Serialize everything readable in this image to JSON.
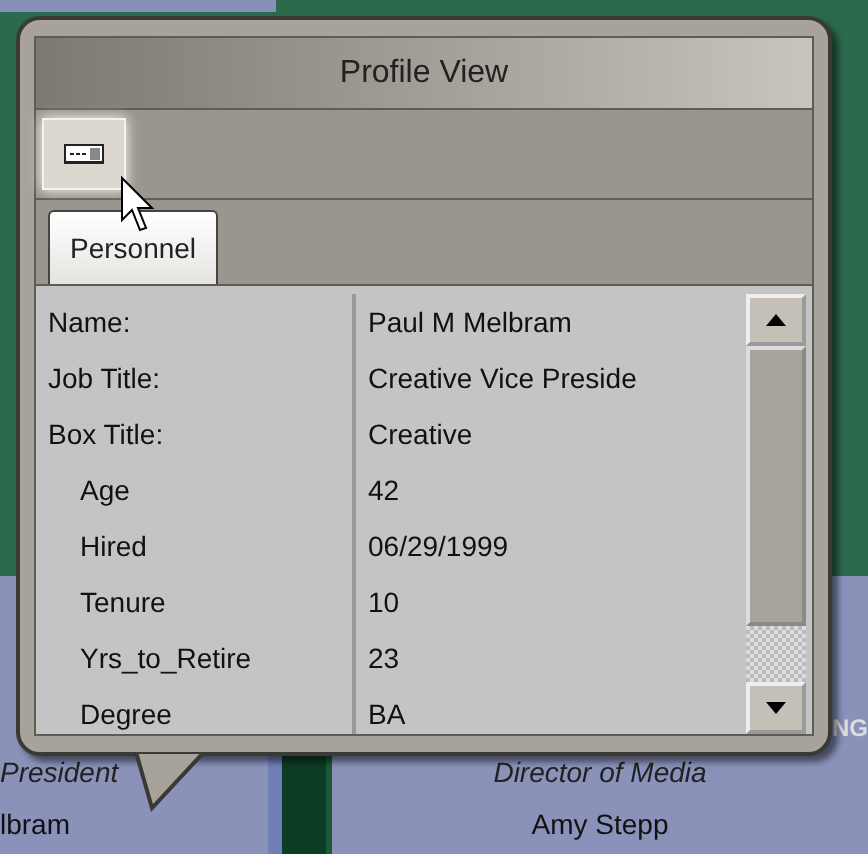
{
  "background": {
    "boxes": [
      {
        "title": "President",
        "name": "lbram"
      },
      {
        "title": "Director of Media",
        "name": "Amy Stepp"
      }
    ],
    "edge_text": "NG"
  },
  "popup": {
    "title": "Profile View",
    "tabs": [
      {
        "label": "Personnel",
        "selected": true
      }
    ],
    "rows": [
      {
        "kind": "field",
        "label": "Name:",
        "value": "Paul M Melbram"
      },
      {
        "kind": "field",
        "label": "Job Title:",
        "value": "Creative Vice Preside"
      },
      {
        "kind": "field",
        "label": "Box Title:",
        "value": "Creative"
      },
      {
        "kind": "detail",
        "label": "Age",
        "value": "42"
      },
      {
        "kind": "detail",
        "label": "Hired",
        "value": "06/29/1999"
      },
      {
        "kind": "detail",
        "label": "Tenure",
        "value": "10"
      },
      {
        "kind": "detail",
        "label": "Yrs_to_Retire",
        "value": "23"
      },
      {
        "kind": "detail",
        "label": "Degree",
        "value": "BA"
      }
    ]
  }
}
